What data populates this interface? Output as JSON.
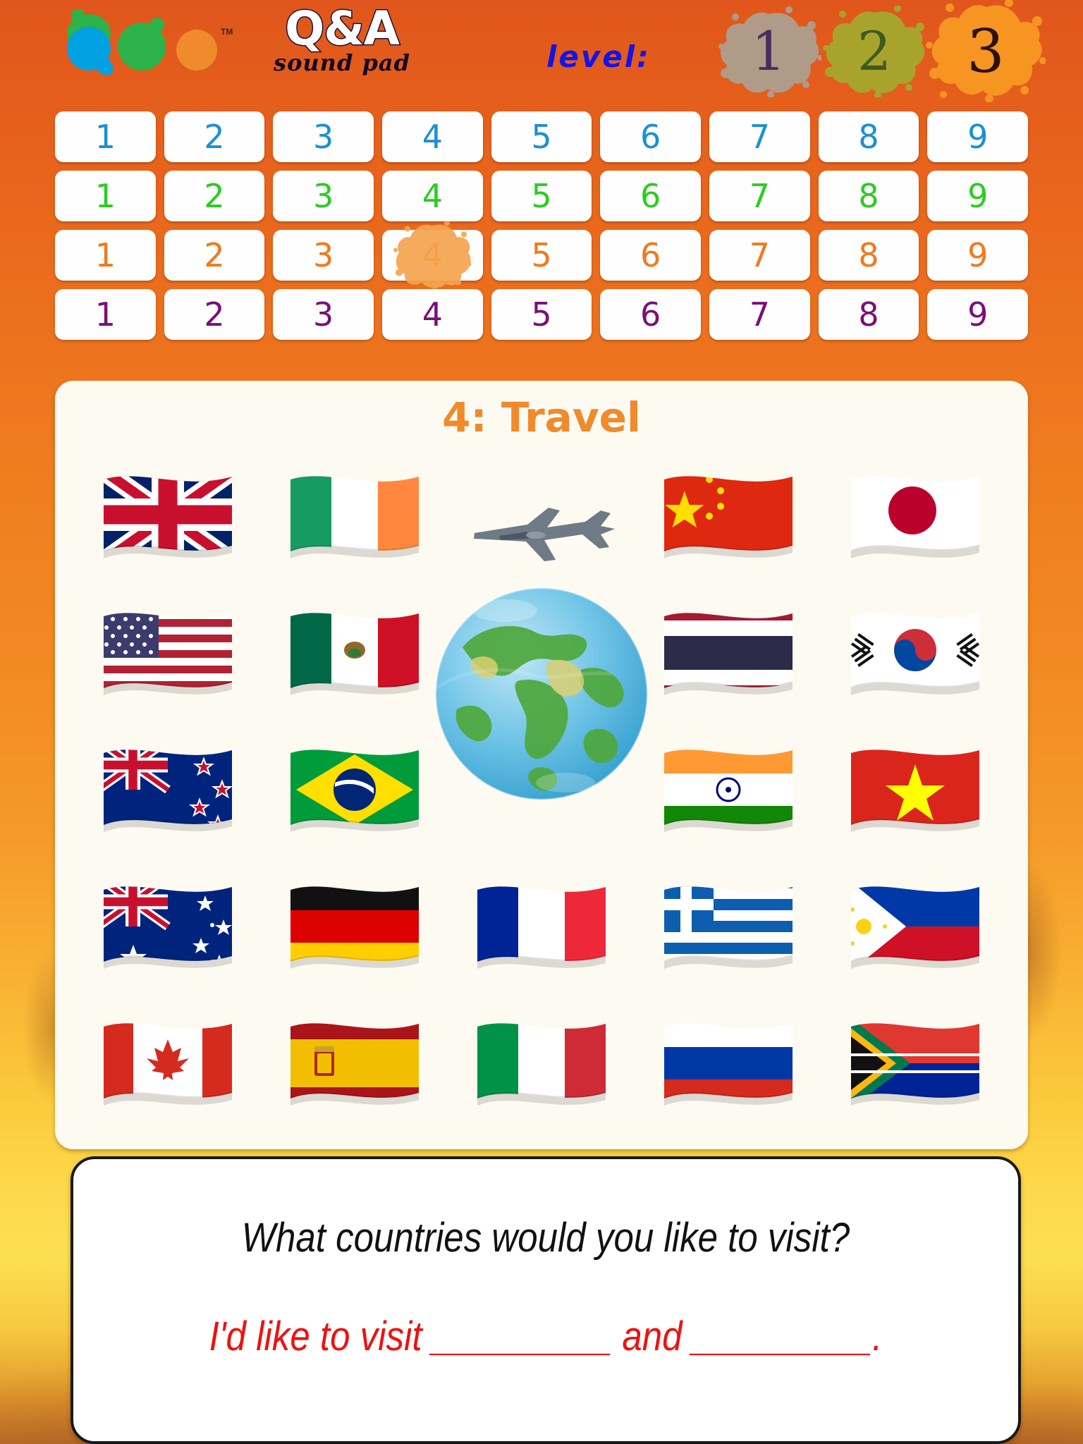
{
  "brand": {
    "logo_name": "speech-bubbles-logo",
    "title": "Q&A",
    "subtitle": "sound pad",
    "trademark": "TM"
  },
  "level": {
    "label": "level:",
    "options": [
      {
        "value": "1",
        "splat_color": "#b09a88",
        "text_color": "#4a2b5e",
        "active": false
      },
      {
        "value": "2",
        "splat_color": "#a8a32c",
        "text_color": "#3e5a1e",
        "active": false
      },
      {
        "value": "3",
        "splat_color": "#f79522",
        "text_color": "#2a1208",
        "active": true
      }
    ]
  },
  "grid": {
    "rows": [
      {
        "color_name": "blue",
        "color": "#1a8fd6",
        "values": [
          "1",
          "2",
          "3",
          "4",
          "5",
          "6",
          "7",
          "8",
          "9"
        ],
        "selected": null
      },
      {
        "color_name": "green",
        "color": "#2ccc22",
        "values": [
          "1",
          "2",
          "3",
          "4",
          "5",
          "6",
          "7",
          "8",
          "9"
        ],
        "selected": null
      },
      {
        "color_name": "orange",
        "color": "#f2791c",
        "values": [
          "1",
          "2",
          "3",
          "4",
          "5",
          "6",
          "7",
          "8",
          "9"
        ],
        "selected": "4"
      },
      {
        "color_name": "purple",
        "color": "#7a0f78",
        "values": [
          "1",
          "2",
          "3",
          "4",
          "5",
          "6",
          "7",
          "8",
          "9"
        ],
        "selected": null
      }
    ]
  },
  "panel": {
    "title": "4: Travel",
    "title_color": "#ef8b2c",
    "center_images": [
      "airplane",
      "earth-globe"
    ],
    "flags": [
      [
        {
          "country": "United Kingdom",
          "name": "flag-united-kingdom"
        },
        {
          "country": "Ireland",
          "name": "flag-ireland"
        },
        {
          "country": "",
          "name": "center-spacer"
        },
        {
          "country": "China",
          "name": "flag-china"
        },
        {
          "country": "Japan",
          "name": "flag-japan"
        }
      ],
      [
        {
          "country": "United States",
          "name": "flag-united-states"
        },
        {
          "country": "Mexico",
          "name": "flag-mexico"
        },
        {
          "country": "",
          "name": "center-spacer"
        },
        {
          "country": "Thailand",
          "name": "flag-thailand"
        },
        {
          "country": "South Korea",
          "name": "flag-south-korea"
        }
      ],
      [
        {
          "country": "New Zealand",
          "name": "flag-new-zealand"
        },
        {
          "country": "Brazil",
          "name": "flag-brazil"
        },
        {
          "country": "",
          "name": "center-spacer"
        },
        {
          "country": "India",
          "name": "flag-india"
        },
        {
          "country": "Vietnam",
          "name": "flag-vietnam"
        }
      ],
      [
        {
          "country": "Australia",
          "name": "flag-australia"
        },
        {
          "country": "Germany",
          "name": "flag-germany"
        },
        {
          "country": "France",
          "name": "flag-france"
        },
        {
          "country": "Greece",
          "name": "flag-greece"
        },
        {
          "country": "Philippines",
          "name": "flag-philippines"
        }
      ],
      [
        {
          "country": "Canada",
          "name": "flag-canada"
        },
        {
          "country": "Spain",
          "name": "flag-spain"
        },
        {
          "country": "Italy",
          "name": "flag-italy"
        },
        {
          "country": "Russia",
          "name": "flag-russia"
        },
        {
          "country": "South Africa",
          "name": "flag-south-africa"
        }
      ]
    ]
  },
  "qa": {
    "question": "What countries would you like to visit?",
    "answer": "I'd like to visit _________ and _________.",
    "question_color": "#111111",
    "answer_color": "#ee1111"
  },
  "theme": {
    "background_top": "#e0561c",
    "background_bottom": "#fce04f",
    "panel_bg": "#fdfaf2",
    "accent": "#ef8b2c"
  }
}
